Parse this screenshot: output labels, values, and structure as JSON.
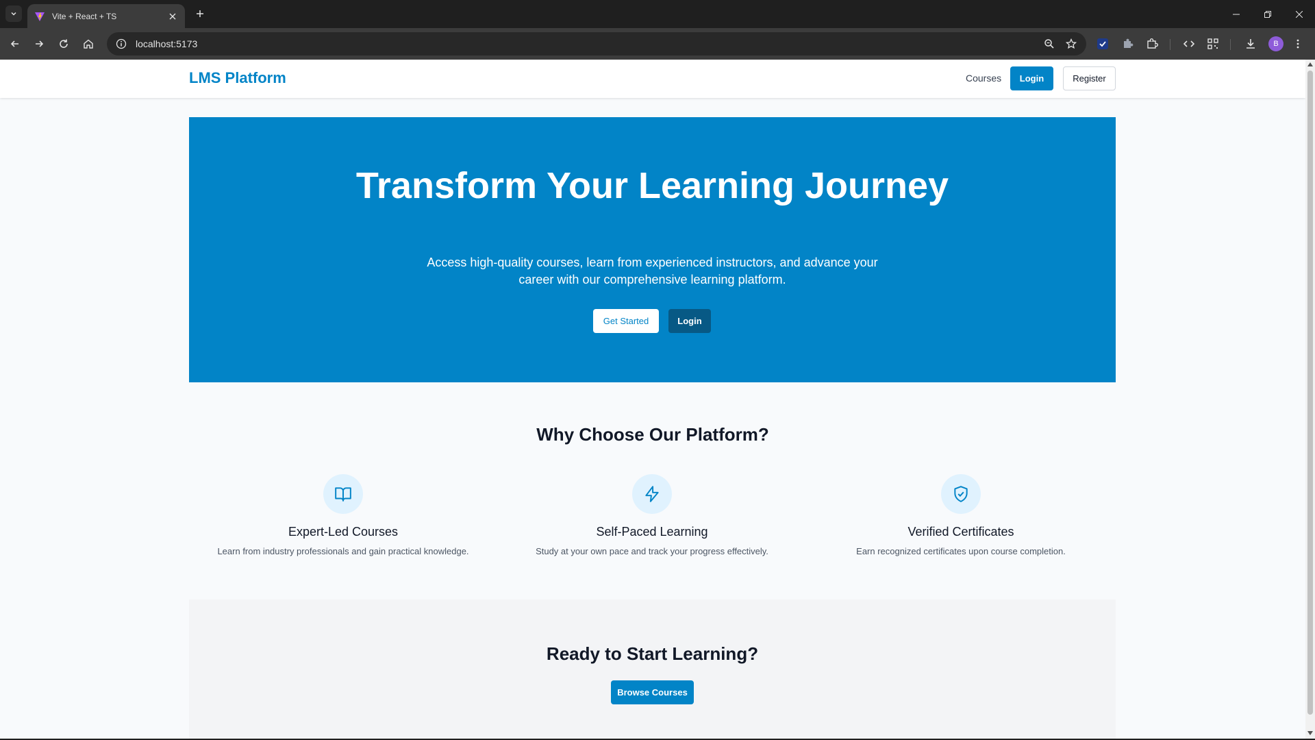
{
  "browser": {
    "tab_title": "Vite + React + TS",
    "url": "localhost:5173",
    "profile_initial": "B"
  },
  "header": {
    "brand": "LMS Platform",
    "nav_courses": "Courses",
    "login_label": "Login",
    "register_label": "Register"
  },
  "hero": {
    "title": "Transform Your Learning Journey",
    "subtitle": "Access high-quality courses, learn from experienced instructors, and advance your career with our comprehensive learning platform.",
    "get_started_label": "Get Started",
    "login_label": "Login"
  },
  "features": {
    "title": "Why Choose Our Platform?",
    "items": [
      {
        "icon": "book-open-icon",
        "title": "Expert-Led Courses",
        "description": "Learn from industry professionals and gain practical knowledge."
      },
      {
        "icon": "lightning-icon",
        "title": "Self-Paced Learning",
        "description": "Study at your own pace and track your progress effectively."
      },
      {
        "icon": "shield-check-icon",
        "title": "Verified Certificates",
        "description": "Earn recognized certificates upon course completion."
      }
    ]
  },
  "cta": {
    "title": "Ready to Start Learning?",
    "button_label": "Browse Courses"
  },
  "colors": {
    "primary": "#0284c7",
    "primary_dark": "#075985",
    "icon_bg": "#e0f2fe"
  }
}
